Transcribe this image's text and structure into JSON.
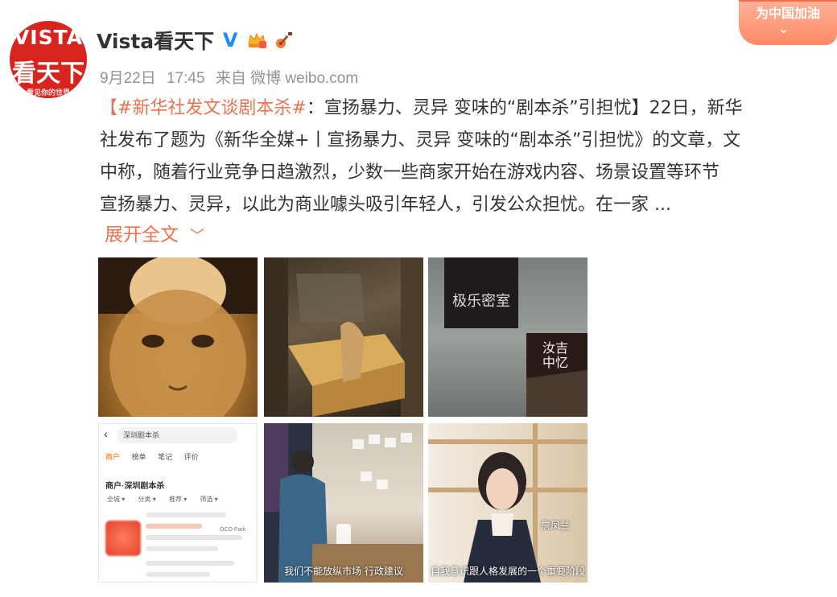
{
  "user": {
    "avatar_lines": [
      "VISTA",
      "看天下",
      "看见你的世界"
    ],
    "name": "Vista看天下"
  },
  "cheer_banner": {
    "label": "为中国加油"
  },
  "meta": {
    "date": "9月22日",
    "time": "17:45",
    "source": "来自 微博 weibo.com"
  },
  "post": {
    "line1_hashtag": "【#新华社发文谈剧本杀#",
    "line1_rest": "：宣扬暴力、灵异 变味的“剧本杀”引担忧】22日，新华",
    "line2": "社发布了题为《新华全媒+丨宣扬暴力、灵异 变味的“剧本杀”引担忧》的文章，文",
    "line3": "中称，随着行业竞争日趋激烈，少数一些商家开始在游戏内容、场景设置等环节",
    "line4": "宣扬暴力、灵异，以此为商业噱头吸引年轻人，引发公众担忧。在一家 ...",
    "expand_label": "展开全文"
  },
  "images": {
    "t3_box1": "极乐密室",
    "t3_box2": "汝吉中忆",
    "t4_search": "深圳剧本杀",
    "t4_tabs": [
      "商户",
      "榜单",
      "笔记",
      "评价"
    ],
    "t4_section": "商户·深圳剧本杀",
    "t4_filters": [
      "全城 ▾",
      "分类 ▾",
      "推荐 ▾",
      "筛选 ▾"
    ],
    "t4_place": "OCO Park",
    "t5_caption": "我们不能放纵市场 行政建议",
    "t6_name": "詹凤兰",
    "t6_caption": "自我意识跟人格发展的一个重要阶段"
  },
  "colors": {
    "accent": "#eb7350",
    "meta": "#939393",
    "verified": "#1a8cff"
  }
}
